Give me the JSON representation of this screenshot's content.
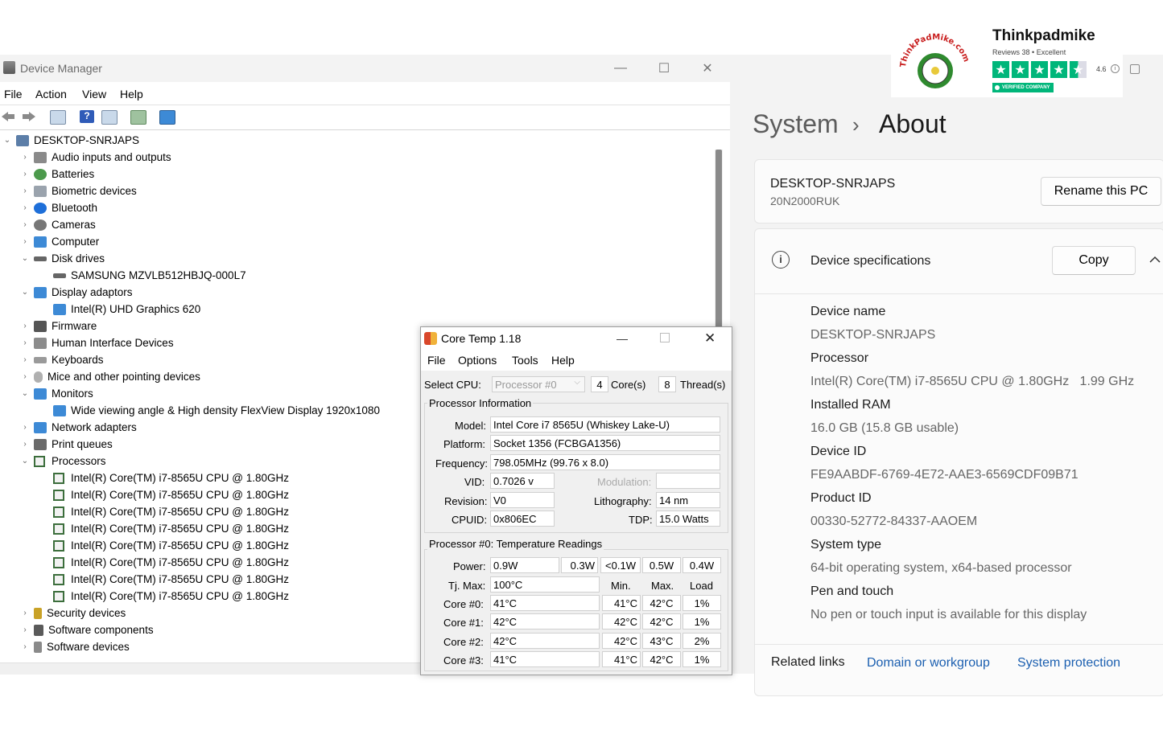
{
  "device_manager": {
    "title": "Device Manager",
    "menu": [
      "File",
      "Action",
      "View",
      "Help"
    ],
    "window_controls": {
      "minimize": "—",
      "maximize": "☐",
      "close": "✕"
    },
    "tree": [
      {
        "label": "DESKTOP-SNRJAPS",
        "expanded": true
      },
      {
        "label": "Audio inputs and outputs"
      },
      {
        "label": "Batteries"
      },
      {
        "label": "Biometric devices"
      },
      {
        "label": "Bluetooth"
      },
      {
        "label": "Cameras"
      },
      {
        "label": "Computer"
      },
      {
        "label": "Disk drives",
        "expanded": true
      },
      {
        "label": "SAMSUNG MZVLB512HBJQ-000L7"
      },
      {
        "label": "Display adaptors",
        "expanded": true
      },
      {
        "label": "Intel(R) UHD Graphics 620"
      },
      {
        "label": "Firmware"
      },
      {
        "label": "Human Interface Devices"
      },
      {
        "label": "Keyboards"
      },
      {
        "label": "Mice and other pointing devices"
      },
      {
        "label": "Monitors",
        "expanded": true
      },
      {
        "label": "Wide viewing angle & High density FlexView Display 1920x1080"
      },
      {
        "label": "Network adapters"
      },
      {
        "label": "Print queues"
      },
      {
        "label": "Processors",
        "expanded": true
      },
      {
        "label": "Intel(R) Core(TM) i7-8565U CPU @ 1.80GHz"
      },
      {
        "label": "Intel(R) Core(TM) i7-8565U CPU @ 1.80GHz"
      },
      {
        "label": "Intel(R) Core(TM) i7-8565U CPU @ 1.80GHz"
      },
      {
        "label": "Intel(R) Core(TM) i7-8565U CPU @ 1.80GHz"
      },
      {
        "label": "Intel(R) Core(TM) i7-8565U CPU @ 1.80GHz"
      },
      {
        "label": "Intel(R) Core(TM) i7-8565U CPU @ 1.80GHz"
      },
      {
        "label": "Intel(R) Core(TM) i7-8565U CPU @ 1.80GHz"
      },
      {
        "label": "Intel(R) Core(TM) i7-8565U CPU @ 1.80GHz"
      },
      {
        "label": "Security devices"
      },
      {
        "label": "Software components"
      },
      {
        "label": "Software devices"
      }
    ]
  },
  "core_temp": {
    "title": "Core Temp 1.18",
    "menu": [
      "File",
      "Options",
      "Tools",
      "Help"
    ],
    "select_cpu_label": "Select CPU:",
    "select_cpu_value": "Processor #0",
    "cores_value": "4",
    "cores_label": "Core(s)",
    "threads_value": "8",
    "threads_label": "Thread(s)",
    "info_group_title": "Processor Information",
    "model_label": "Model:",
    "model_value": "Intel Core i7 8565U (Whiskey Lake-U)",
    "platform_label": "Platform:",
    "platform_value": "Socket 1356 (FCBGA1356)",
    "frequency_label": "Frequency:",
    "frequency_value": "798.05MHz (99.76 x 8.0)",
    "vid_label": "VID:",
    "vid_value": "0.7026 v",
    "modulation_label": "Modulation:",
    "revision_label": "Revision:",
    "revision_value": "V0",
    "lithography_label": "Lithography:",
    "lithography_value": "14 nm",
    "cpuid_label": "CPUID:",
    "cpuid_value": "0x806EC",
    "tdp_label": "TDP:",
    "tdp_value": "15.0 Watts",
    "temp_group_title": "Processor #0: Temperature Readings",
    "power_label": "Power:",
    "power_values": [
      "0.9W",
      "0.3W",
      "<0.1W",
      "0.5W",
      "0.4W"
    ],
    "tjmax_label": "Tj. Max:",
    "tjmax_value": "100°C",
    "col_min": "Min.",
    "col_max": "Max.",
    "col_load": "Load",
    "cores": [
      {
        "label": "Core #0:",
        "temp": "41°C",
        "min": "41°C",
        "max": "42°C",
        "load": "1%"
      },
      {
        "label": "Core #1:",
        "temp": "42°C",
        "min": "42°C",
        "max": "42°C",
        "load": "1%"
      },
      {
        "label": "Core #2:",
        "temp": "42°C",
        "min": "42°C",
        "max": "43°C",
        "load": "2%"
      },
      {
        "label": "Core #3:",
        "temp": "41°C",
        "min": "41°C",
        "max": "42°C",
        "load": "1%"
      }
    ]
  },
  "settings": {
    "breadcrumb_parent": "System",
    "breadcrumb_sep": "›",
    "breadcrumb_current": "About",
    "pc_name": "DESKTOP-SNRJAPS",
    "pc_model": "20N2000RUK",
    "rename_button": "Rename this PC",
    "spec_section_title": "Device specifications",
    "copy_button": "Copy",
    "specs": [
      {
        "key": "Device name",
        "value": "DESKTOP-SNRJAPS"
      },
      {
        "key": "Processor",
        "value": "Intel(R) Core(TM) i7-8565U CPU @ 1.80GHz   1.99 GHz"
      },
      {
        "key": "Installed RAM",
        "value": "16.0 GB (15.8 GB usable)"
      },
      {
        "key": "Device ID",
        "value": "FE9AABDF-6769-4E72-AAE3-6569CDF09B71"
      },
      {
        "key": "Product ID",
        "value": "00330-52772-84337-AAOEM"
      },
      {
        "key": "System type",
        "value": "64-bit operating system, x64-based processor"
      },
      {
        "key": "Pen and touch",
        "value": "No pen or touch input is available for this display"
      }
    ],
    "related_links_label": "Related links",
    "links": [
      "Domain or workgroup",
      "System protection"
    ]
  },
  "badge": {
    "logo_text": "ThinkPadMike.com",
    "name": "Thinkpadmike",
    "reviews": "Reviews 38",
    "dot": "•",
    "rating_word": "Excellent",
    "rating": "4.6",
    "stars": 4.5,
    "verified": "VERIFIED COMPANY",
    "accent": "#00b67a"
  }
}
